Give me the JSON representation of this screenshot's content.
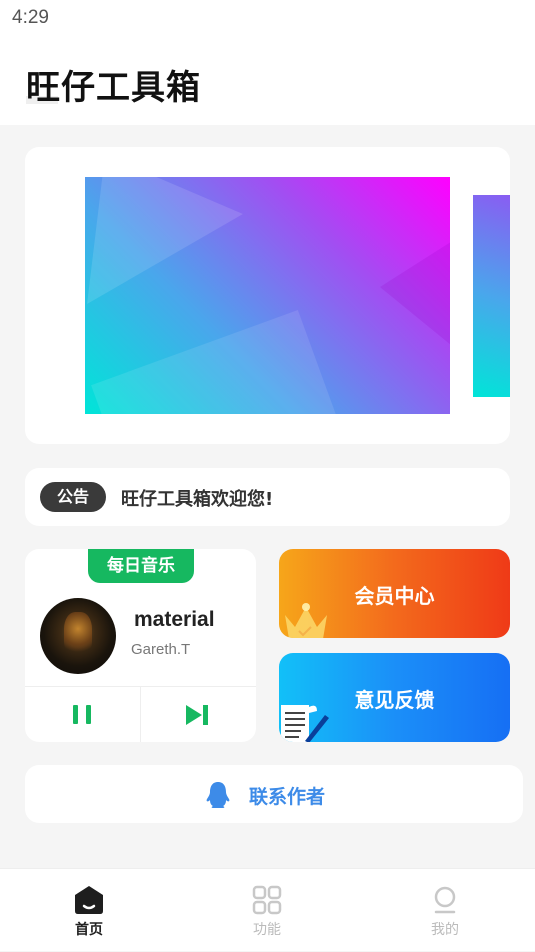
{
  "status_bar": {
    "time": "4:29"
  },
  "header": {
    "title": "旺仔工具箱"
  },
  "notice": {
    "badge": "公告",
    "text": "旺仔工具箱欢迎您!"
  },
  "music": {
    "tag": "每日音乐",
    "title": "material",
    "artist": "Gareth.T",
    "accent": "#16b860"
  },
  "vip": {
    "label": "会员中心"
  },
  "feedback": {
    "label": "意见反馈"
  },
  "contact": {
    "label": "联系作者"
  },
  "bottom_nav": {
    "items": [
      {
        "label": "首页",
        "icon": "home-icon",
        "active": true
      },
      {
        "label": "功能",
        "icon": "grid-icon",
        "active": false
      },
      {
        "label": "我的",
        "icon": "profile-icon",
        "active": false
      }
    ]
  },
  "colors": {
    "background": "#f5f5f5",
    "card": "#ffffff",
    "vip_gradient": [
      "#f6a61a",
      "#ef3a17"
    ],
    "feedback_gradient": [
      "#12c0f8",
      "#166ff4"
    ],
    "contact_text": "#3d8be8"
  }
}
